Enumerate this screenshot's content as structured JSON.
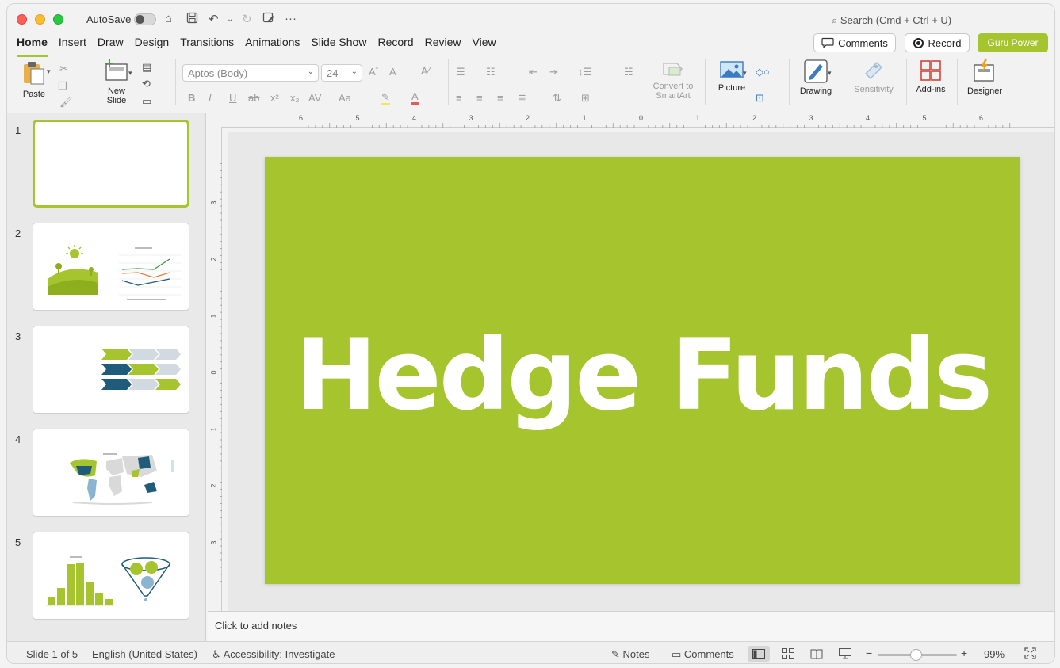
{
  "app": {
    "autosave_label": "AutoSave",
    "search_placeholder": "Search (Cmd + Ctrl + U)"
  },
  "tabs": [
    "Home",
    "Insert",
    "Draw",
    "Design",
    "Transitions",
    "Animations",
    "Slide Show",
    "Record",
    "Review",
    "View"
  ],
  "active_tab": "Home",
  "header_buttons": {
    "comments": "Comments",
    "record": "Record",
    "guru": "Guru Power"
  },
  "ribbon": {
    "paste": "Paste",
    "new_slide_line1": "New",
    "new_slide_line2": "Slide",
    "font_name": "Aptos (Body)",
    "font_size": "24",
    "convert_line1": "Convert to",
    "convert_line2": "SmartArt",
    "picture": "Picture",
    "drawing": "Drawing",
    "sensitivity": "Sensitivity",
    "addins": "Add-ins",
    "designer": "Designer"
  },
  "slides": [
    {
      "number": "1"
    },
    {
      "number": "2"
    },
    {
      "number": "3"
    },
    {
      "number": "4"
    },
    {
      "number": "5"
    }
  ],
  "current_slide": {
    "title": "Hedge Funds",
    "background_color": "#A5C42E"
  },
  "ruler_top_labels": [
    "6",
    "5",
    "4",
    "3",
    "2",
    "1",
    "0",
    "1",
    "2",
    "3",
    "4",
    "5",
    "6"
  ],
  "ruler_left_labels": [
    "3",
    "2",
    "1",
    "0",
    "1",
    "2",
    "3"
  ],
  "notes_placeholder": "Click to add notes",
  "status": {
    "slide_indicator": "Slide 1 of 5",
    "language": "English (United States)",
    "accessibility": "Accessibility: Investigate",
    "notes": "Notes",
    "comments": "Comments",
    "zoom_minus": "−",
    "zoom_plus": "+",
    "zoom_level": "99%"
  },
  "colors": {
    "accent": "#A5C42E",
    "dark_blue": "#1F5B7A"
  }
}
